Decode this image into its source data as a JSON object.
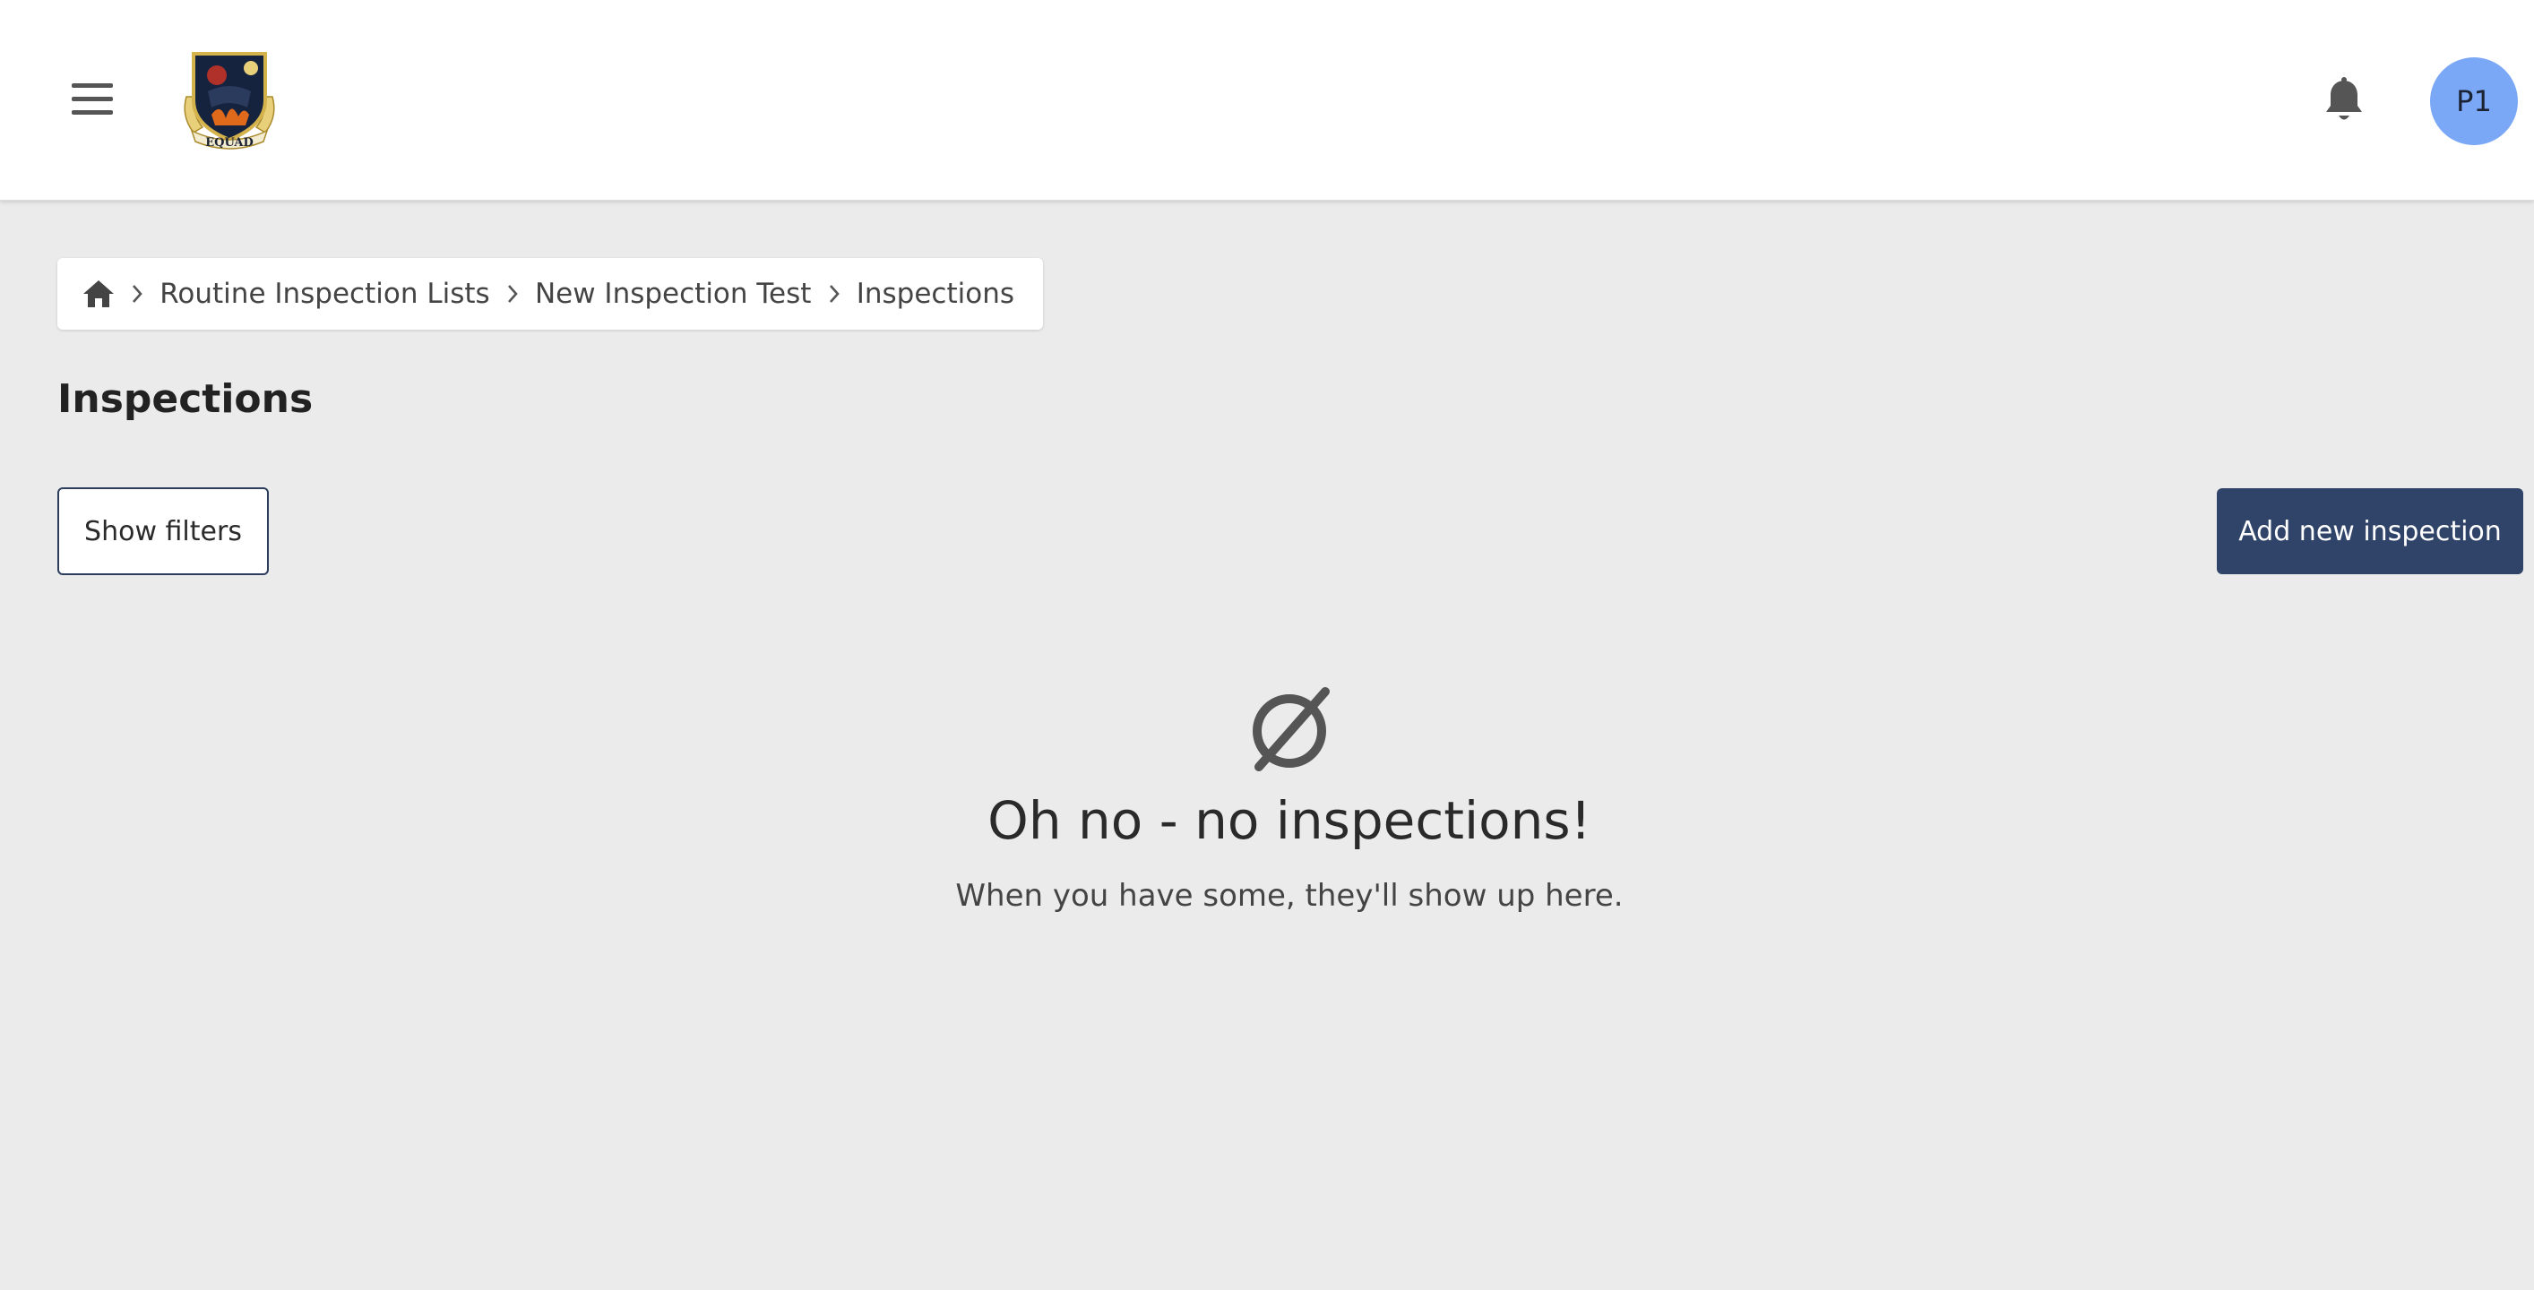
{
  "header": {
    "menu_icon": "hamburger-menu-icon",
    "logo_icon": "equad-crest-logo",
    "logo_text": "EQUAD",
    "notifications_icon": "bell-icon",
    "avatar_initials": "P1",
    "avatar_color": "#7aa7f6"
  },
  "breadcrumb": {
    "home_icon": "home-icon",
    "separator_icon": "chevron-right-icon",
    "items": [
      "Routine Inspection Lists",
      "New Inspection Test",
      "Inspections"
    ]
  },
  "page": {
    "title": "Inspections"
  },
  "toolbar": {
    "show_filters_label": "Show filters",
    "add_label": "Add new inspection",
    "add_color": "#2f4468"
  },
  "empty_state": {
    "icon": "empty-set-icon",
    "title": "Oh no - no inspections!",
    "subtitle": "When you have some, they'll show up here."
  }
}
